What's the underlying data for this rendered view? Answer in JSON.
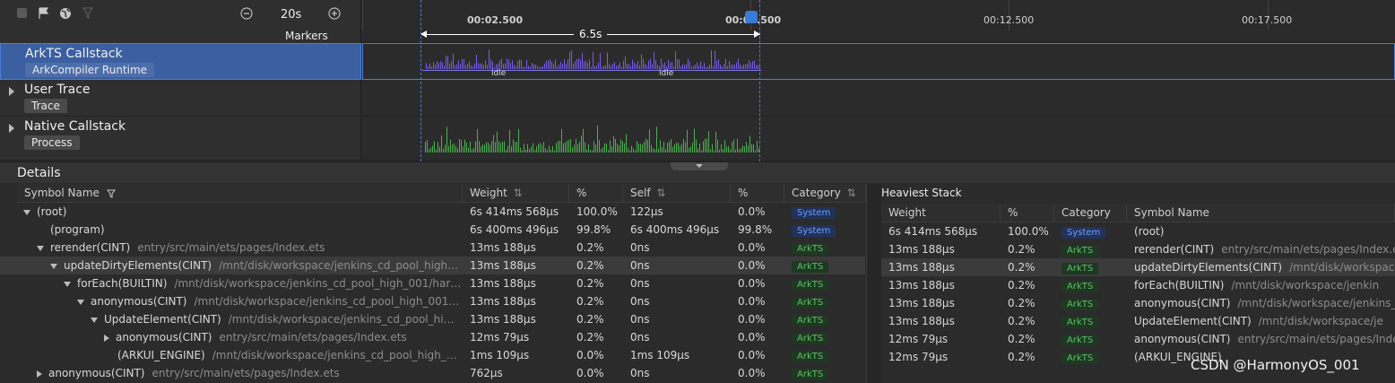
{
  "toolbar": {
    "zoom_label": "20s",
    "markers_label": "Markers",
    "icons": [
      "stop-icon",
      "flag-icon",
      "globe-icon",
      "filter-icon",
      "zoom-out-icon",
      "zoom-in-icon"
    ]
  },
  "ruler": {
    "ticks": [
      "00:02.500",
      "00:07.500",
      "00:12.500",
      "00:17.500"
    ],
    "selection_duration": "6.5s"
  },
  "tracks": [
    {
      "title": "ArkTS Callstack",
      "tag": "ArkCompiler Runtime",
      "expandable": false,
      "selected": true,
      "lane_labels": [
        "idle",
        "idle"
      ]
    },
    {
      "title": "User Trace",
      "tag": "Trace",
      "expandable": true,
      "selected": false
    },
    {
      "title": "Native Callstack",
      "tag": "Process",
      "expandable": true,
      "selected": false
    }
  ],
  "details": {
    "title": "Details",
    "columns": [
      "Symbol Name",
      "Weight",
      "%",
      "Self",
      "%",
      "Category"
    ],
    "rows": [
      {
        "indent": 0,
        "expander": "down",
        "symbol": "(root)",
        "path": "",
        "weight": "6s 414ms 568μs",
        "weight_pct": "100.0%",
        "self": "122μs",
        "self_pct": "0.0%",
        "category": "System",
        "selected": false
      },
      {
        "indent": 1,
        "expander": "none",
        "symbol": "(program)",
        "path": "",
        "weight": "6s 400ms 496μs",
        "weight_pct": "99.8%",
        "self": "6s 400ms 496μs",
        "self_pct": "99.8%",
        "category": "System",
        "selected": false
      },
      {
        "indent": 1,
        "expander": "down",
        "symbol": "rerender(CINT)",
        "path": "entry/src/main/ets/pages/Index.ets",
        "weight": "13ms 188μs",
        "weight_pct": "0.2%",
        "self": "0ns",
        "self_pct": "0.0%",
        "category": "ArkTS",
        "selected": false
      },
      {
        "indent": 2,
        "expander": "down",
        "symbol": "updateDirtyElements(CINT)",
        "path": "/mnt/disk/workspace/jenkins_cd_pool_high…",
        "weight": "13ms 188μs",
        "weight_pct": "0.2%",
        "self": "0ns",
        "self_pct": "0.0%",
        "category": "ArkTS",
        "selected": true
      },
      {
        "indent": 3,
        "expander": "down",
        "symbol": "forEach(BUILTIN)",
        "path": "/mnt/disk/workspace/jenkins_cd_pool_high_001/har…",
        "weight": "13ms 188μs",
        "weight_pct": "0.2%",
        "self": "0ns",
        "self_pct": "0.0%",
        "category": "ArkTS",
        "selected": false
      },
      {
        "indent": 4,
        "expander": "down",
        "symbol": "anonymous(CINT)",
        "path": "/mnt/disk/workspace/jenkins_cd_pool_high_001…",
        "weight": "13ms 188μs",
        "weight_pct": "0.2%",
        "self": "0ns",
        "self_pct": "0.0%",
        "category": "ArkTS",
        "selected": false
      },
      {
        "indent": 5,
        "expander": "down",
        "symbol": "UpdateElement(CINT)",
        "path": "/mnt/disk/workspace/jenkins_cd_pool_hi…",
        "weight": "13ms 188μs",
        "weight_pct": "0.2%",
        "self": "0ns",
        "self_pct": "0.0%",
        "category": "ArkTS",
        "selected": false
      },
      {
        "indent": 6,
        "expander": "right",
        "symbol": "anonymous(CINT)",
        "path": "entry/src/main/ets/pages/Index.ets",
        "weight": "12ms 79μs",
        "weight_pct": "0.2%",
        "self": "0ns",
        "self_pct": "0.0%",
        "category": "ArkTS",
        "selected": false
      },
      {
        "indent": 6,
        "expander": "none",
        "symbol": "(ARKUI_ENGINE)",
        "path": "/mnt/disk/workspace/jenkins_cd_pool_high_…",
        "weight": "1ms 109μs",
        "weight_pct": "0.0%",
        "self": "1ms 109μs",
        "self_pct": "0.0%",
        "category": "ArkTS",
        "selected": false
      },
      {
        "indent": 1,
        "expander": "right",
        "symbol": "anonymous(CINT)",
        "path": "entry/src/main/ets/pages/Index.ets",
        "weight": "762μs",
        "weight_pct": "0.0%",
        "self": "0ns",
        "self_pct": "0.0%",
        "category": "ArkTS",
        "selected": false
      }
    ]
  },
  "heaviest": {
    "title": "Heaviest Stack",
    "columns": [
      "Weight",
      "%",
      "Category",
      "Symbol Name"
    ],
    "rows": [
      {
        "weight": "6s 414ms 568μs",
        "pct": "100.0%",
        "category": "System",
        "symbol": "(root)",
        "path": "",
        "selected": false
      },
      {
        "weight": "13ms 188μs",
        "pct": "0.2%",
        "category": "ArkTS",
        "symbol": "rerender(CINT)",
        "path": "entry/src/main/ets/pages/Index.e",
        "selected": false
      },
      {
        "weight": "13ms 188μs",
        "pct": "0.2%",
        "category": "ArkTS",
        "symbol": "updateDirtyElements(CINT)",
        "path": "/mnt/disk/workspace",
        "selected": true
      },
      {
        "weight": "13ms 188μs",
        "pct": "0.2%",
        "category": "ArkTS",
        "symbol": "forEach(BUILTIN)",
        "path": "/mnt/disk/workspace/jenkin",
        "selected": false
      },
      {
        "weight": "13ms 188μs",
        "pct": "0.2%",
        "category": "ArkTS",
        "symbol": "anonymous(CINT)",
        "path": "/mnt/disk/workspace/jenkins_",
        "selected": false
      },
      {
        "weight": "13ms 188μs",
        "pct": "0.2%",
        "category": "ArkTS",
        "symbol": "UpdateElement(CINT)",
        "path": "/mnt/disk/workspace/je",
        "selected": false
      },
      {
        "weight": "12ms 79μs",
        "pct": "0.2%",
        "category": "ArkTS",
        "symbol": "anonymous(CINT)",
        "path": "entry/src/main/ets/pages/Inde",
        "selected": false
      },
      {
        "weight": "12ms 79μs",
        "pct": "0.2%",
        "category": "ArkTS",
        "symbol": "(ARKUI_ENGINE)",
        "path": "",
        "selected": false
      }
    ]
  },
  "watermark": "CSDN @HarmonyOS_001",
  "colors": {
    "selection": "#3b5fa0",
    "selection_border": "#4a7fd8",
    "arkts_bars": "#7a5ce8",
    "native_bars": "#4caf50",
    "system_badge": "#6aa0ff",
    "arkts_badge": "#5fbf6a"
  }
}
